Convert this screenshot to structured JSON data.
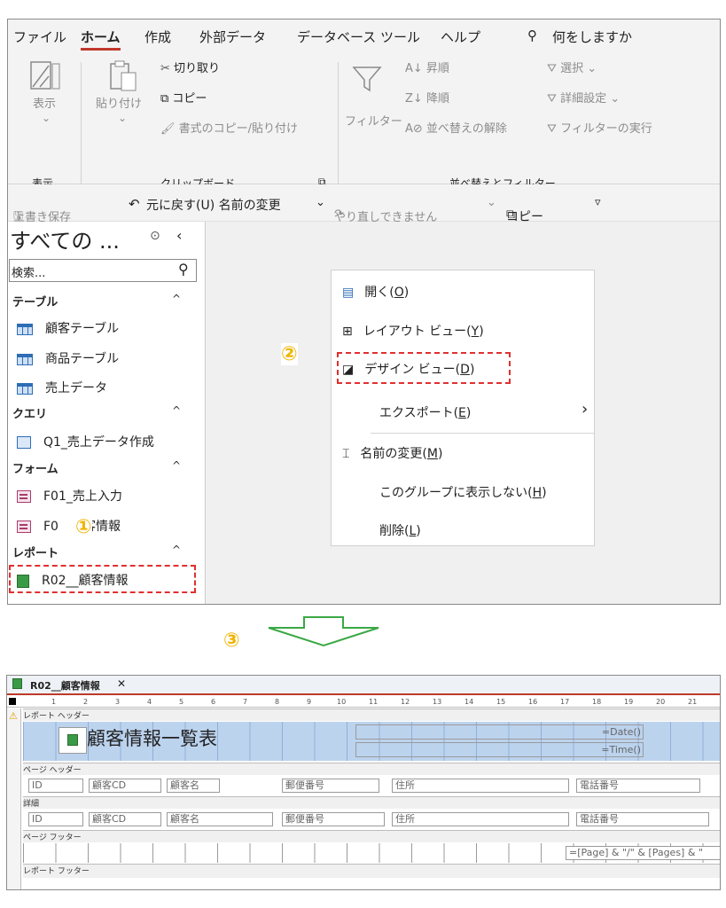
{
  "menubar": {
    "items": [
      "ファイル",
      "ホーム",
      "作成",
      "外部データ",
      "データベース ツール",
      "ヘルプ"
    ],
    "active": "ホーム",
    "tell_me": "何をしますか"
  },
  "ribbon": {
    "view": {
      "label": "表示",
      "chevron": "⌄",
      "group": "表示"
    },
    "clipboard": {
      "paste": "貼り付け",
      "cut": "切り取り",
      "copy": "コピー",
      "format_painter": "書式のコピー/貼り付け",
      "group": "クリップボード",
      "launcher": "⧉"
    },
    "sort_filter": {
      "filter": "フィルター",
      "ascending": "昇順",
      "descending": "降順",
      "clear_sort": "並べ替えの解除",
      "selection": "選択 ⌄",
      "advanced": "詳細設定 ⌄",
      "toggle_filter": "フィルターの実行",
      "group": "並べ替えとフィルター"
    }
  },
  "qat": {
    "save": "上書き保存",
    "undo": "元に戻す(U) 名前の変更",
    "undo_chevron": "⌄",
    "redo": "やり直しできません",
    "redo_chevron": "⌄",
    "copy": "コピー",
    "customize": "▿"
  },
  "nav": {
    "title": "すべての ...",
    "search_placeholder": "検索...",
    "groups": [
      {
        "label": "テーブル",
        "items": [
          "顧客テーブル",
          "商品テーブル",
          "売上データ"
        ]
      },
      {
        "label": "クエリ",
        "items": [
          "Q1_売上データ作成"
        ]
      },
      {
        "label": "フォーム",
        "items": [
          "F01_売上入力",
          "F0　　客情報"
        ]
      },
      {
        "label": "レポート",
        "items": [
          "R02__顧客情報"
        ]
      }
    ]
  },
  "context_menu": {
    "items": [
      {
        "label": "開く(",
        "key": "O",
        "end": ")"
      },
      {
        "label": "レイアウト ビュー(",
        "key": "Y",
        "end": ")"
      },
      {
        "label": "デザイン ビュー(",
        "key": "D",
        "end": ")"
      },
      {
        "label": "エクスポート(",
        "key": "E",
        "end": ")",
        "submenu": "›"
      },
      {
        "label": "名前の変更(",
        "key": "M",
        "end": ")"
      },
      {
        "label": "このグループに表示しない(",
        "key": "H",
        "end": ")"
      },
      {
        "label": "削除(",
        "key": "L",
        "end": ")"
      }
    ]
  },
  "annotations": {
    "step1": "①",
    "step2": "②",
    "step3": "③"
  },
  "design_view": {
    "tab_title": "R02__顧客情報",
    "close": "✕",
    "ruler": [
      "1",
      "2",
      "3",
      "4",
      "5",
      "6",
      "7",
      "8",
      "9",
      "10",
      "11",
      "12",
      "13",
      "14",
      "15",
      "16",
      "17",
      "18",
      "19",
      "20",
      "21"
    ],
    "sections": {
      "report_header": "レポート ヘッダー",
      "page_header": "ページ ヘッダー",
      "detail": "詳細",
      "page_footer": "ページ フッター",
      "report_footer": "レポート フッター"
    },
    "report_title": "顧客情報一覧表",
    "date_expr": "=Date()",
    "time_expr": "=Time()",
    "header_labels": [
      "ID",
      "顧客CD",
      "顧客名",
      "郵便番号",
      "住所",
      "電話番号"
    ],
    "detail_fields": [
      "ID",
      "顧客CD",
      "顧客名",
      "郵便番号",
      "住所",
      "電話番号"
    ],
    "page_expr": "=[Page] & \"/\" & [Pages] & \""
  },
  "colors": {
    "accent_red": "#c0392b",
    "dash_red": "#e03030",
    "step_yellow": "#f0b400",
    "arrow_green": "#3aa845",
    "section_blue": "#bcd3ee"
  }
}
